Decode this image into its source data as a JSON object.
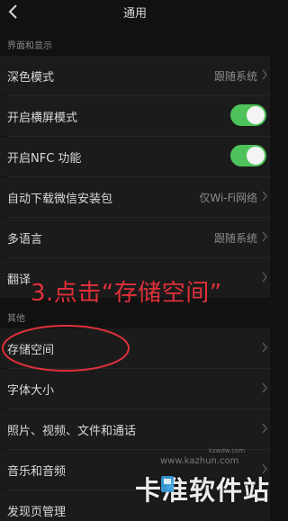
{
  "header": {
    "title": "通用"
  },
  "sections": {
    "display": {
      "label": "界面和显示"
    },
    "other": {
      "label": "其他"
    }
  },
  "rows": [
    {
      "label": "深色模式",
      "value": "跟随系统",
      "chevron": true
    },
    {
      "label": "开启横屏模式",
      "toggle": "on"
    },
    {
      "label": "开启NFC 功能",
      "toggle": "on"
    },
    {
      "label": "自动下载微信安装包",
      "value": "仅Wi-Fi网络",
      "chevron": true
    },
    {
      "label": "多语言",
      "value": "跟随系统",
      "chevron": true
    },
    {
      "label": "翻译",
      "chevron": true
    },
    {
      "label": "存储空间",
      "chevron": true
    },
    {
      "label": "字体大小",
      "chevron": true
    },
    {
      "label": "照片、视频、文件和通话",
      "chevron": true
    },
    {
      "label": "音乐和音频",
      "chevron": true
    },
    {
      "label": "发现页管理",
      "chevron": true
    }
  ],
  "annotation": {
    "text": "3.点击“存储空间”",
    "color": "#e0303a"
  },
  "watermark": {
    "text": "卡准软件站",
    "url": "www.kazhun.com",
    "url_small": "kzwdw.com"
  },
  "colors": {
    "toggle_on": "#4fc35b",
    "background": "#111111",
    "row_bg": "#1b1b1b"
  }
}
